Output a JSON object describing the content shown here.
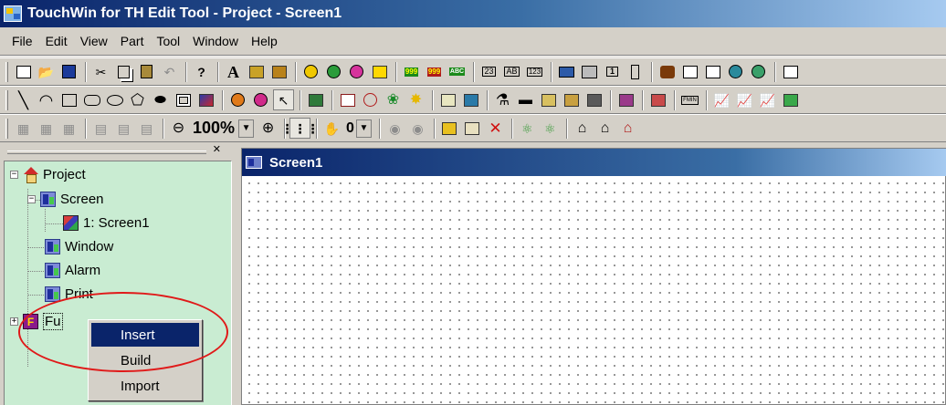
{
  "window": {
    "title": "TouchWin for TH Edit Tool - Project - Screen1"
  },
  "menubar": {
    "items": [
      "File",
      "Edit",
      "View",
      "Part",
      "Tool",
      "Window",
      "Help"
    ]
  },
  "toolbar_view": {
    "zoom_value": "100%",
    "layer_value": "0"
  },
  "text_tool_glyphs": {
    "text": "A",
    "num_a": "999",
    "num_b": "999",
    "abc": "ABC",
    "n23": "23",
    "ab": "AB",
    "n123": "123",
    "one": "1",
    "fmin": "FMIN"
  },
  "project_tree": {
    "root": "Project",
    "screen": "Screen",
    "screen1": "1: Screen1",
    "window": "Window",
    "alarm": "Alarm",
    "print": "Print",
    "function": "Function",
    "function_visible": "Fu"
  },
  "context_menu": {
    "items": [
      "Insert",
      "Build",
      "Import"
    ],
    "highlighted": "Insert"
  },
  "document": {
    "title": "Screen1"
  },
  "colors": {
    "titlebar_start": "#0a246a",
    "titlebar_end": "#a6caf0",
    "menu_highlight": "#0a246a",
    "tree_background": "#c9ecd2",
    "annotation_ring": "#e01919"
  },
  "icons": {
    "toolbar_1": [
      "new-file-icon",
      "open-folder-icon",
      "save-icon",
      "cut-icon",
      "copy-icon",
      "paste-icon",
      "undo-icon",
      "help-icon",
      "text-icon",
      "text-large-icon",
      "text-double-icon",
      "lamp-icon",
      "button-icon",
      "record-icon",
      "flag-icon",
      "numeric-display-icon",
      "numeric-input-icon",
      "char-input-icon",
      "char-display-icon",
      "msg-icon",
      "num-icon",
      "keyboard-icon",
      "printer-icon",
      "transfer-icon",
      "window-icon",
      "network-icon"
    ],
    "toolbar_2": [
      "line-icon",
      "arc-icon",
      "rectangle-icon",
      "rounded-rectangle-icon",
      "ellipse-icon",
      "circle-icon",
      "polygon-icon",
      "sector-icon",
      "frame-icon",
      "picture-icon",
      "paint-icon",
      "cursor-icon",
      "gauge-icon",
      "clock-icon",
      "meter-icon",
      "fan-icon",
      "light-icon",
      "alarm-list-icon",
      "bar-graph-icon",
      "trend-icon",
      "xy-graph-icon",
      "area-graph-icon"
    ],
    "toolbar_3": [
      "align-icon",
      "align-center-icon",
      "zoom-out-icon",
      "zoom-in-icon",
      "grid-icon",
      "hand-icon",
      "undo-history-icon",
      "redo-history-icon",
      "properties-icon",
      "edit-icon",
      "delete-icon",
      "shift-up-icon",
      "shift-down-icon"
    ]
  }
}
